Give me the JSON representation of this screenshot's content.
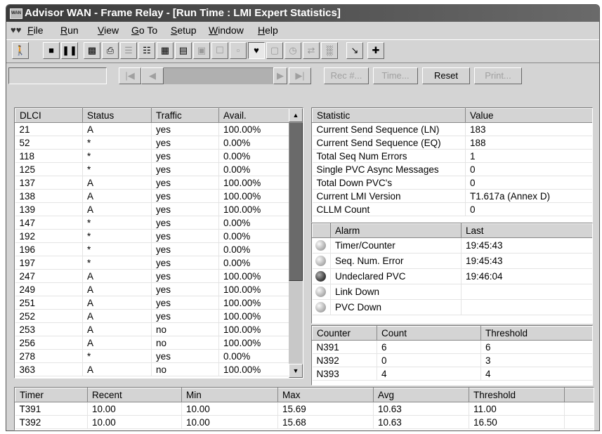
{
  "window": {
    "title": "Advisor WAN - Frame Relay - [Run Time : LMI Expert Statistics]",
    "app_icon_text": "WAN"
  },
  "menu": [
    {
      "label": "File",
      "mnemonic": "F",
      "rest": "ile"
    },
    {
      "label": "Run",
      "mnemonic": "R",
      "rest": "un"
    },
    {
      "label": "View",
      "mnemonic": "V",
      "rest": "iew"
    },
    {
      "label": "Go To",
      "mnemonic": "G",
      "rest": "o To"
    },
    {
      "label": "Setup",
      "mnemonic": "S",
      "rest": "etup"
    },
    {
      "label": "Window",
      "mnemonic": "W",
      "rest": "indow"
    },
    {
      "label": "Help",
      "mnemonic": "H",
      "rest": "elp"
    }
  ],
  "toolbar": {
    "icons": [
      "exit-run-icon",
      "stop-icon",
      "pause-icon",
      "bar-chart-icon",
      "printer-view-icon",
      "text-view-icon",
      "list-view-icon",
      "grid-view-icon",
      "table-view-icon",
      "summary-view-icon",
      "search-view-icon",
      "network-view-icon",
      "lmi-stats-icon",
      "capture-icon",
      "timer-icon",
      "transfer-icon",
      "histogram-icon",
      "pointer-icon",
      "add-icon"
    ]
  },
  "navbar": {
    "rec_label": "Rec #...",
    "time_label": "Time...",
    "reset_label": "Reset",
    "print_label": "Print..."
  },
  "dlci_table": {
    "headers": [
      "DLCI",
      "Status",
      "Traffic",
      "Avail."
    ],
    "rows": [
      [
        "21",
        "A",
        "yes",
        "100.00%"
      ],
      [
        "52",
        "*",
        "yes",
        "0.00%"
      ],
      [
        "118",
        "*",
        "yes",
        "0.00%"
      ],
      [
        "125",
        "*",
        "yes",
        "0.00%"
      ],
      [
        "137",
        "A",
        "yes",
        "100.00%"
      ],
      [
        "138",
        "A",
        "yes",
        "100.00%"
      ],
      [
        "139",
        "A",
        "yes",
        "100.00%"
      ],
      [
        "147",
        "*",
        "yes",
        "0.00%"
      ],
      [
        "192",
        "*",
        "yes",
        "0.00%"
      ],
      [
        "196",
        "*",
        "yes",
        "0.00%"
      ],
      [
        "197",
        "*",
        "yes",
        "0.00%"
      ],
      [
        "247",
        "A",
        "yes",
        "100.00%"
      ],
      [
        "249",
        "A",
        "yes",
        "100.00%"
      ],
      [
        "251",
        "A",
        "yes",
        "100.00%"
      ],
      [
        "252",
        "A",
        "yes",
        "100.00%"
      ],
      [
        "253",
        "A",
        "no",
        "100.00%"
      ],
      [
        "256",
        "A",
        "no",
        "100.00%"
      ],
      [
        "278",
        "*",
        "yes",
        "0.00%"
      ],
      [
        "363",
        "A",
        "no",
        "100.00%"
      ]
    ]
  },
  "stats_table": {
    "headers": [
      "Statistic",
      "Value"
    ],
    "rows": [
      [
        "Current Send Sequence (LN)",
        "183"
      ],
      [
        "Current Send Sequence (EQ)",
        "188"
      ],
      [
        "Total Seq Num Errors",
        "1"
      ],
      [
        "Single PVC Async Messages",
        "0"
      ],
      [
        "Total Down PVC's",
        "0"
      ],
      [
        "Current LMI Version",
        "T1.617a (Annex D)"
      ],
      [
        "CLLM Count",
        "0"
      ]
    ]
  },
  "alarm_table": {
    "headers": [
      "Alarm",
      "Last"
    ],
    "rows": [
      {
        "name": "Timer/Counter",
        "last": "19:45:43",
        "active": false
      },
      {
        "name": "Seq. Num. Error",
        "last": "19:45:43",
        "active": false
      },
      {
        "name": "Undeclared PVC",
        "last": "19:46:04",
        "active": true
      },
      {
        "name": "Link Down",
        "last": "",
        "active": false
      },
      {
        "name": "PVC Down",
        "last": "",
        "active": false
      }
    ]
  },
  "counter_table": {
    "headers": [
      "Counter",
      "Count",
      "Threshold"
    ],
    "rows": [
      [
        "N391",
        "6",
        "6"
      ],
      [
        "N392",
        "0",
        "3"
      ],
      [
        "N393",
        "4",
        "4"
      ]
    ]
  },
  "timer_table": {
    "headers": [
      "Timer",
      "Recent",
      "Min",
      "Max",
      "Avg",
      "Threshold"
    ],
    "rows": [
      [
        "T391",
        "10.00",
        "10.00",
        "15.69",
        "10.63",
        "11.00"
      ],
      [
        "T392",
        "10.00",
        "10.00",
        "15.68",
        "10.63",
        "16.50"
      ]
    ]
  }
}
